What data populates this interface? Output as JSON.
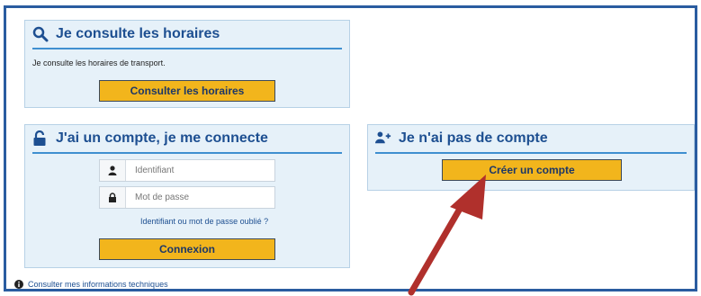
{
  "schedules": {
    "title": "Je consulte les horaires",
    "description": "Je consulte les horaires de transport.",
    "button_label": "Consulter les horaires"
  },
  "login": {
    "title": "J'ai un compte, je me connecte",
    "username_placeholder": "Identifiant",
    "password_placeholder": "Mot de passe",
    "forgot_link": "Identifiant ou mot de passe oublié ?",
    "button_label": "Connexion"
  },
  "register": {
    "title": "Je n'ai pas de compte",
    "button_label": "Créer un compte"
  },
  "footer": {
    "tech_info_link": "Consulter mes informations techniques"
  },
  "colors": {
    "frame_border": "#2a5ca0",
    "panel_bg": "#e6f1f9",
    "accent_button": "#f2b51c",
    "title_text": "#1d4f91",
    "arrow": "#b0302c"
  },
  "icons": {
    "schedules": "search-icon",
    "login": "unlock-icon",
    "register": "user-plus-icon",
    "username": "user-icon",
    "password": "lock-icon",
    "info": "info-icon",
    "annotation": "red-arrow"
  }
}
